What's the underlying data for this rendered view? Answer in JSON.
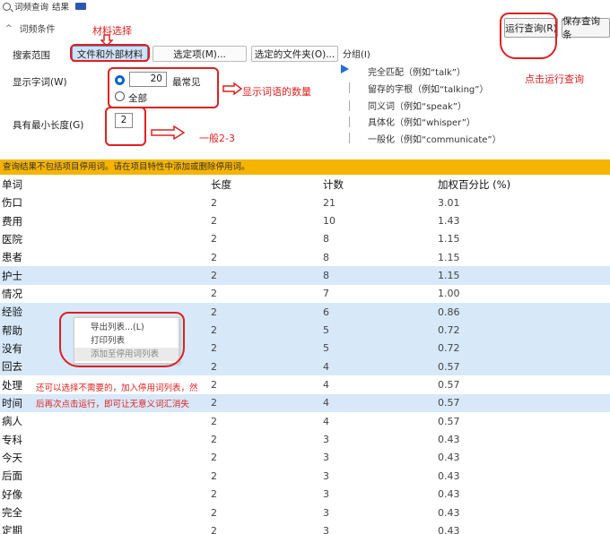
{
  "topbar": {
    "tab1": "词频查询",
    "tab2": "结果"
  },
  "panel": {
    "section_title": "词频条件",
    "search_scope_label": "搜索范围",
    "scope_options": [
      "文件和外部材料",
      "选定项(M)...",
      "选定的文件夹(O)..."
    ],
    "display_label": "显示字词(W)",
    "display_count": "20",
    "most_common_label": "最常见",
    "all_label": "全部",
    "minlen_label": "具有最小长度(G)",
    "minlen_value": "2",
    "grouping_label": "分组(I)",
    "grouping_items": [
      "完全匹配（例如“talk”）",
      "留存的字根（例如“talking”）",
      "同义词（例如“speak”）",
      "具体化（例如“whisper”）",
      "一般化（例如“communicate”）"
    ],
    "run_button": "运行查询(R)",
    "save_button": "保存查询条"
  },
  "annotations": {
    "material": "材料选择",
    "run": "点击运行查询",
    "display": "显示词语的数量",
    "minlen": "一般2-3",
    "stopword": "还可以选择不需要的，加入停用词列表，然",
    "stopword2": "后再次点击运行，即可让无意义词汇消失"
  },
  "notice": "查询结果不包括项目停用词。请在项目特性中添加或删除停用词。",
  "table": {
    "headers": [
      "单词",
      "长度",
      "计数",
      "加权百分比 (%)"
    ],
    "rows": [
      [
        "伤口",
        "2",
        "21",
        "3.01"
      ],
      [
        "费用",
        "2",
        "10",
        "1.43"
      ],
      [
        "医院",
        "2",
        "8",
        "1.15"
      ],
      [
        "患者",
        "2",
        "8",
        "1.15"
      ],
      [
        "护士",
        "2",
        "8",
        "1.15"
      ],
      [
        "情况",
        "2",
        "7",
        "1.00"
      ],
      [
        "经验",
        "2",
        "6",
        "0.86"
      ],
      [
        "帮助",
        "2",
        "5",
        "0.72"
      ],
      [
        "没有",
        "2",
        "5",
        "0.72"
      ],
      [
        "回去",
        "2",
        "4",
        "0.57"
      ],
      [
        "处理",
        "2",
        "4",
        "0.57"
      ],
      [
        "时间",
        "2",
        "4",
        "0.57"
      ],
      [
        "病人",
        "2",
        "4",
        "0.57"
      ],
      [
        "专科",
        "2",
        "3",
        "0.43"
      ],
      [
        "今天",
        "2",
        "3",
        "0.43"
      ],
      [
        "后面",
        "2",
        "3",
        "0.43"
      ],
      [
        "好像",
        "2",
        "3",
        "0.43"
      ],
      [
        "完全",
        "2",
        "3",
        "0.43"
      ],
      [
        "定期",
        "2",
        "3",
        "0.43"
      ]
    ]
  },
  "context_menu": [
    "导出列表...(L)",
    "打印列表",
    "添加至停用词列表"
  ],
  "colors": {
    "accent": "#0a63c9",
    "annotation": "#e02020",
    "notice_bg": "#f5b400",
    "highlight": "#d7e8f8"
  }
}
